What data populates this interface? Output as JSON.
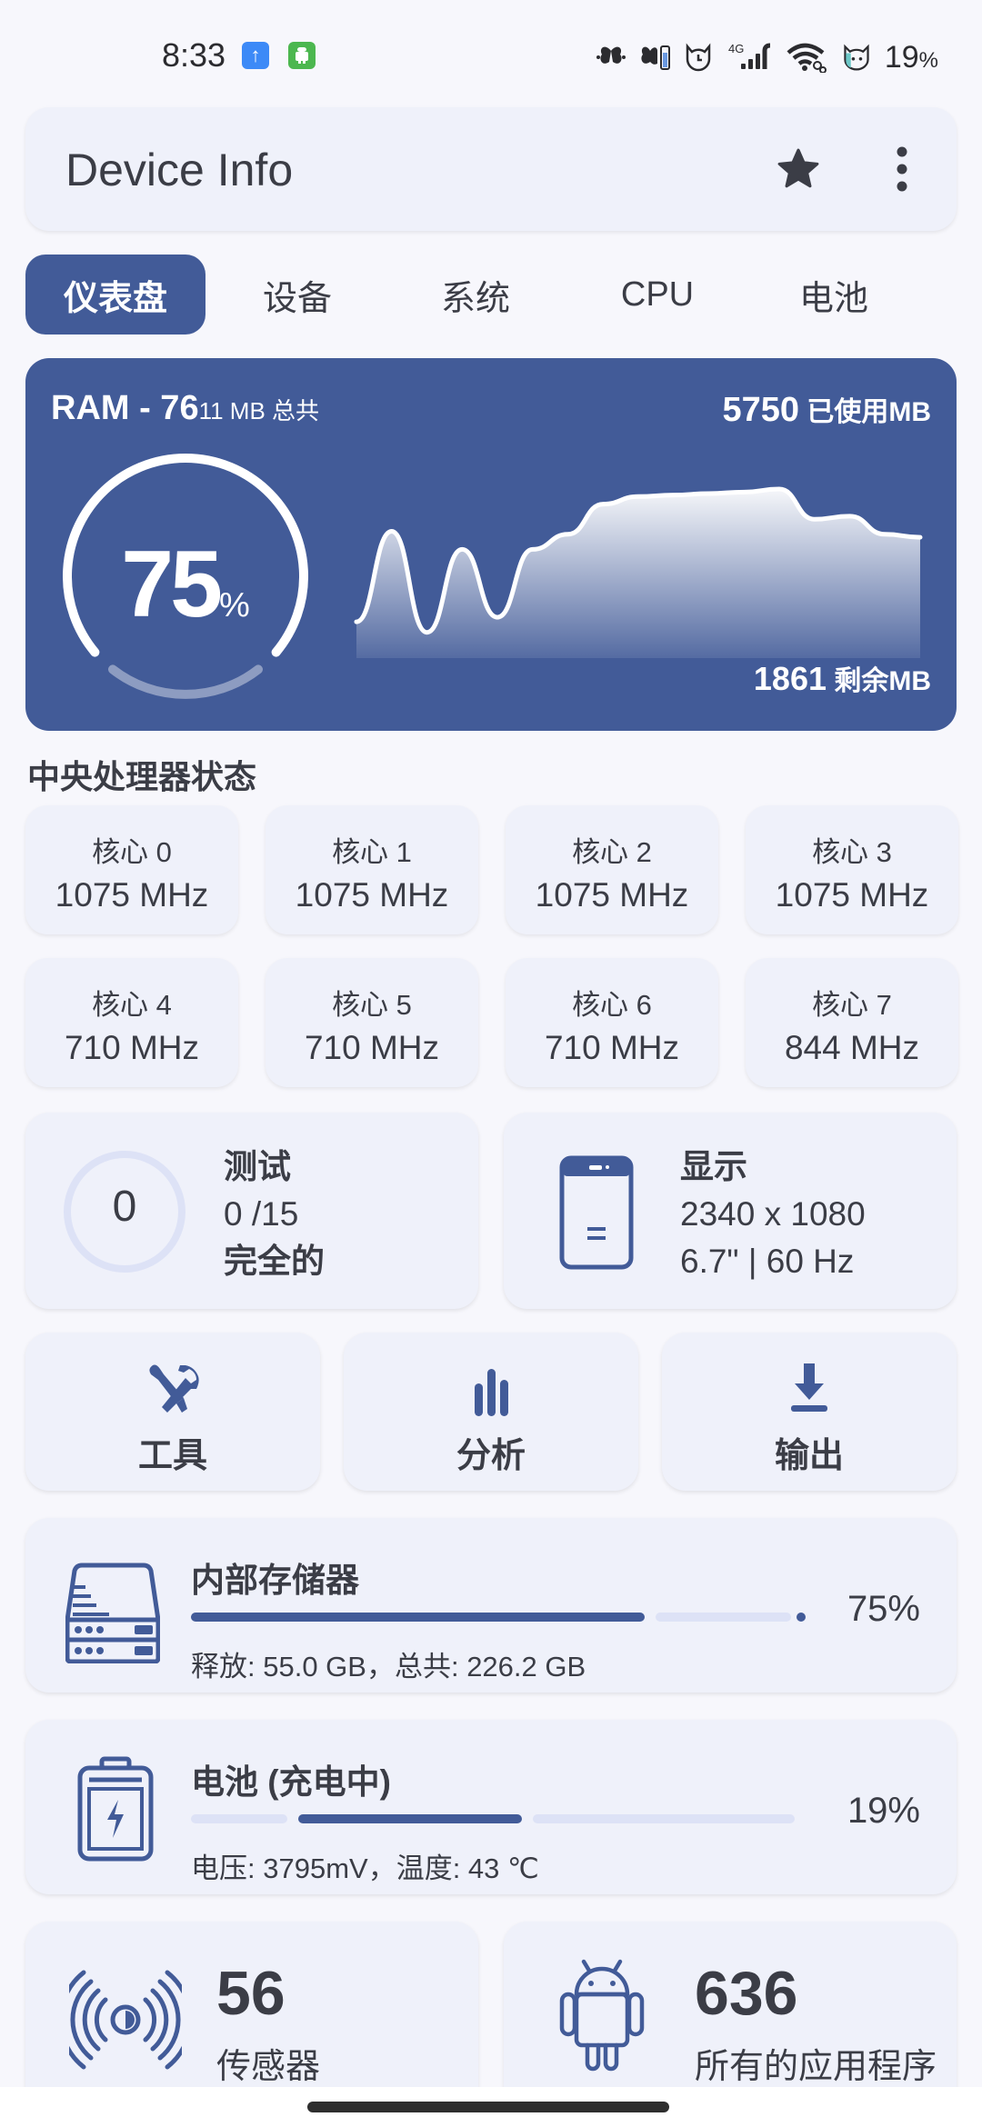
{
  "status_bar": {
    "time": "8:33",
    "notifications": [
      "upload-icon",
      "android-icon"
    ],
    "indicators": [
      "butterfly-icon",
      "butterfly-battery-icon",
      "cat-alarm-icon",
      "4g-signal-icon",
      "wifi-link-icon",
      "cat-battery-icon"
    ],
    "network_label": "4G",
    "battery_value": "19",
    "battery_unit": "%"
  },
  "app_bar": {
    "title": "Device Info",
    "actions": [
      "star-icon",
      "more-vert-icon"
    ]
  },
  "tabs": [
    {
      "label": "仪表盘",
      "active": true
    },
    {
      "label": "设备",
      "active": false
    },
    {
      "label": "系统",
      "active": false
    },
    {
      "label": "CPU",
      "active": false
    },
    {
      "label": "电池",
      "active": false
    }
  ],
  "ram": {
    "title_prefix": "RAM - 76",
    "title_suffix": "11 MB 总共",
    "total_mb": 7611,
    "used_value": "5750",
    "used_label": " 已使用MB",
    "free_value": "1861",
    "free_label": " 剩余MB",
    "percent_value": "75",
    "percent_unit": "%",
    "usage_fraction": 0.75,
    "history": [
      0.12,
      0.72,
      0.05,
      0.6,
      0.15,
      0.6,
      0.7,
      0.9,
      0.95,
      0.96,
      0.97,
      0.98,
      1.0,
      0.8,
      0.82,
      0.7,
      0.68
    ]
  },
  "cpu": {
    "section_title": "中央处理器状态",
    "cores": [
      {
        "name": "核心 0",
        "freq": "1075 MHz"
      },
      {
        "name": "核心 1",
        "freq": "1075 MHz"
      },
      {
        "name": "核心 2",
        "freq": "1075 MHz"
      },
      {
        "name": "核心 3",
        "freq": "1075 MHz"
      },
      {
        "name": "核心 4",
        "freq": "710 MHz"
      },
      {
        "name": "核心 5",
        "freq": "710 MHz"
      },
      {
        "name": "核心 6",
        "freq": "710 MHz"
      },
      {
        "name": "核心 7",
        "freq": "844 MHz"
      }
    ]
  },
  "tests": {
    "count": "0",
    "title": "测试",
    "progress": "0 /15",
    "status": "完全的",
    "completed_fraction": 0
  },
  "display": {
    "title": "显示",
    "resolution": "2340 x 1080",
    "details": "6.7\" | 60 Hz"
  },
  "actions": [
    {
      "label": "工具",
      "icon": "tools-icon"
    },
    {
      "label": "分析",
      "icon": "bar-chart-icon"
    },
    {
      "label": "输出",
      "icon": "download-icon"
    }
  ],
  "storage": {
    "title": "内部存储器",
    "detail": "释放: 55.0 GB，总共: 226.2 GB",
    "percent": "75%",
    "used_fraction": 0.75
  },
  "battery": {
    "title": "电池 (充电中)",
    "detail": "电压: 3795mV，温度: 43 ℃",
    "percent": "19%",
    "level_fraction": 0.19
  },
  "sensors": {
    "count": "56",
    "label": "传感器"
  },
  "apps": {
    "count": "636",
    "label": "所有的应用程序"
  },
  "colors": {
    "accent": "#425b98",
    "card_bg": "#eff1fa",
    "page_bg": "#f7f7fc",
    "track": "#dde2f6",
    "text": "#3b3d46"
  }
}
